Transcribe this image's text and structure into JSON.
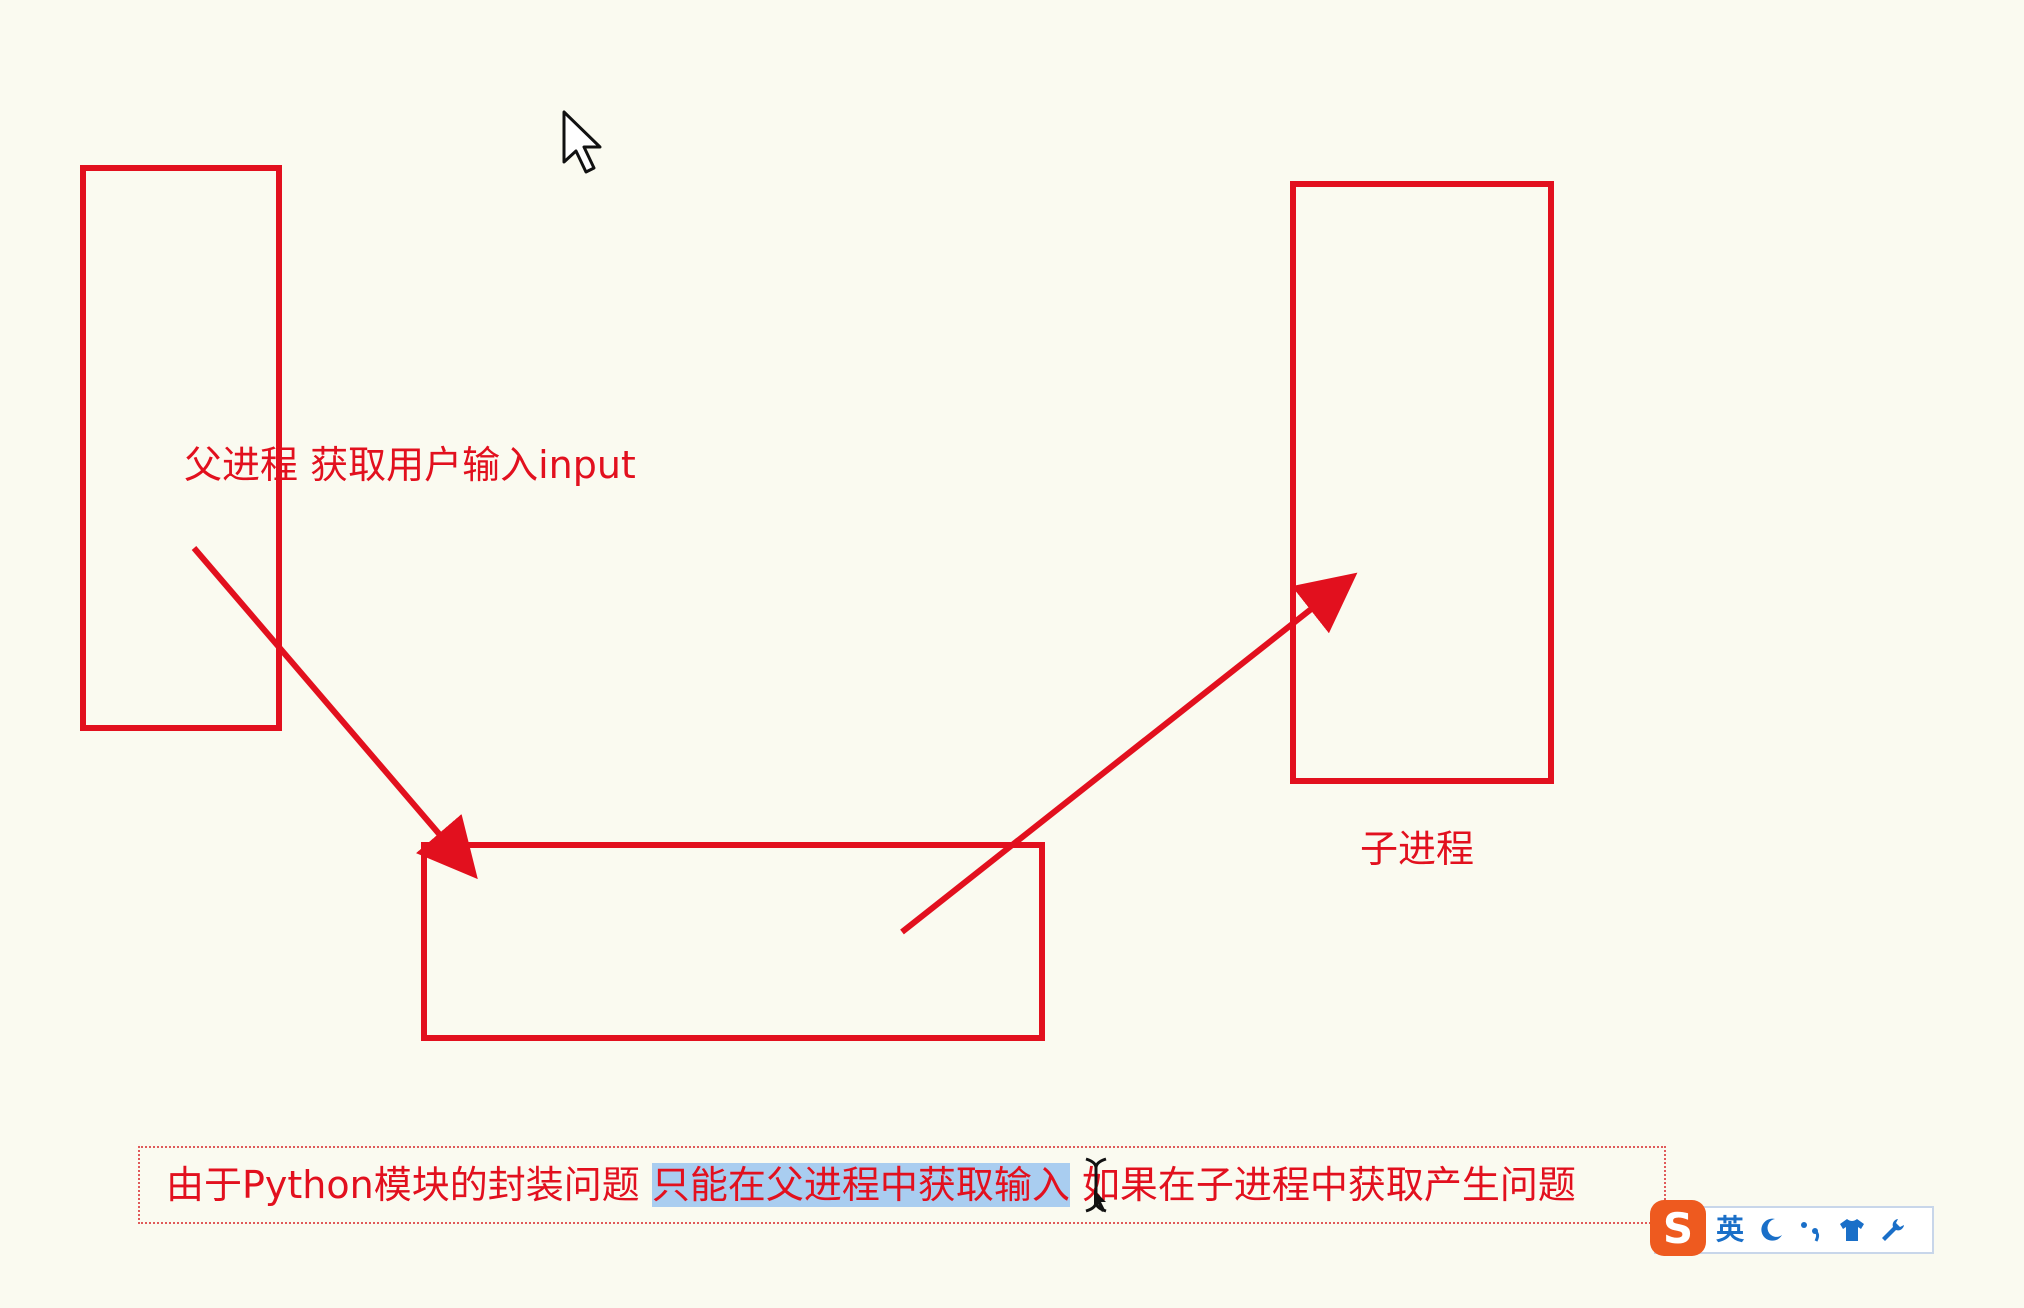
{
  "diagram": {
    "parent_label": "父进程  获取用户输入input",
    "child_label": "子进程"
  },
  "textbox": {
    "prefix": "由于Python模块的封装问题 ",
    "selected": "只能在父进程中获取输入",
    "suffix": " 如果在子进程中获取产生问题"
  },
  "ime": {
    "logo": "S",
    "lang": "英",
    "icons": [
      "moon-icon",
      "punctuation-icon",
      "skin-shirt-icon",
      "wrench-icon"
    ]
  },
  "colors": {
    "accent": "#e2101e",
    "background": "#fafaf0",
    "selection": "#a9cdf0",
    "ime_logo": "#ee5a1f",
    "ime_icon": "#1a6fc8"
  }
}
